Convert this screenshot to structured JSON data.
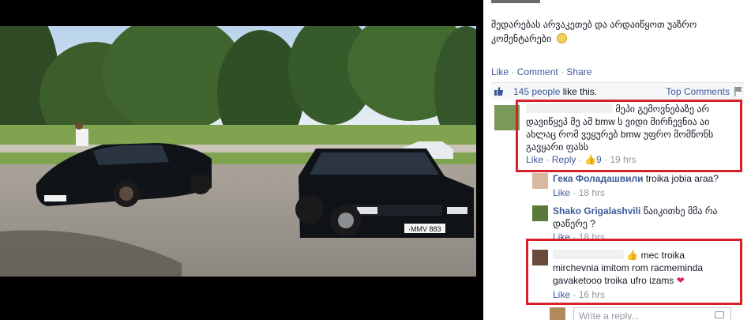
{
  "post": {
    "caption": "შედარებას არვაკეთებ და არდაიწყოთ უაზრო კომენტარები",
    "actions": [
      "Like",
      "Comment",
      "Share"
    ],
    "likes_count_text": "145 people",
    "likes_suffix": "like this.",
    "sort_label": "Top Comments"
  },
  "photo": {
    "plate_left": "MMV 883",
    "plate_right": "·MMV 883"
  },
  "comments": [
    {
      "author": "",
      "text": "მეპი გემოვნებაზე არ დავიწყეპ მე ამ bmw ს ვიდი მირჩევნია აი ახლაც რომ ვეყურებ bmw უფრო მომწონს გავყარი ფასს",
      "like_label": "Like",
      "reply_label": "Reply",
      "likes": "9",
      "time": "19 hrs"
    },
    {
      "author": "Гека Фоладашвили",
      "text": "troika jobia araa?",
      "like_label": "Like",
      "time": "18 hrs"
    },
    {
      "author": "Shako Grigalashvili",
      "text": "წაიკითხე მმა რა დაწერე ?",
      "like_label": "Like",
      "time": "18 hrs"
    },
    {
      "author": "",
      "text_a": "mec troika",
      "text_b": "mirchevnia imitom rom racmeminda gavaketooo troika ufro izams",
      "like_label": "Like",
      "time": "16 hrs"
    }
  ],
  "composer": {
    "placeholder": "Write a reply..."
  },
  "colors": {
    "link": "#3b5998",
    "highlight": "#d6212c",
    "muted": "#9197a3"
  },
  "icons": [
    "like-thumb-icon",
    "flag-icon",
    "camera-icon",
    "heart-icon",
    "smile-emoji-icon"
  ]
}
